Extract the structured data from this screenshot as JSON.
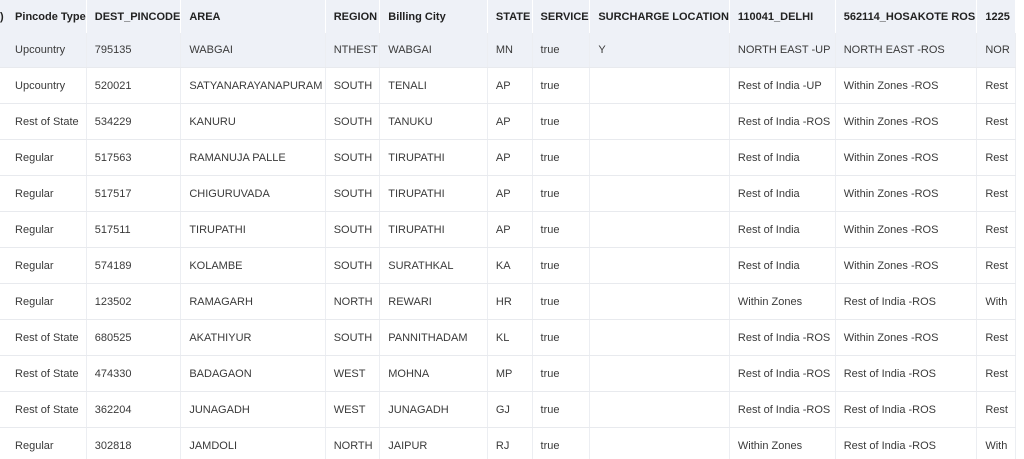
{
  "columns": [
    "Pincode Type",
    "DEST_PINCODE",
    "AREA",
    "REGION",
    "Billing City",
    "STATE",
    "SERVICE",
    "SURCHARGE LOCATION",
    "110041_DELHI",
    "562114_HOSAKOTE ROS",
    "1225"
  ],
  "rows": [
    [
      "Upcountry",
      "795135",
      "WABGAI",
      "NTHEST",
      "WABGAI",
      "MN",
      "true",
      "Y",
      "NORTH EAST -UP",
      "NORTH EAST -ROS",
      "NOR"
    ],
    [
      "Upcountry",
      "520021",
      "SATYANARAYANAPURAM",
      "SOUTH",
      "TENALI",
      "AP",
      "true",
      "",
      "Rest of India -UP",
      "Within Zones -ROS",
      "Rest"
    ],
    [
      "Rest of State",
      "534229",
      "KANURU",
      "SOUTH",
      "TANUKU",
      "AP",
      "true",
      "",
      "Rest of India -ROS",
      "Within Zones -ROS",
      "Rest"
    ],
    [
      "Regular",
      "517563",
      "RAMANUJA PALLE",
      "SOUTH",
      "TIRUPATHI",
      "AP",
      "true",
      "",
      "Rest of India",
      "Within Zones -ROS",
      "Rest"
    ],
    [
      "Regular",
      "517517",
      "CHIGURUVADA",
      "SOUTH",
      "TIRUPATHI",
      "AP",
      "true",
      "",
      "Rest of India",
      "Within Zones -ROS",
      "Rest"
    ],
    [
      "Regular",
      "517511",
      "TIRUPATHI",
      "SOUTH",
      "TIRUPATHI",
      "AP",
      "true",
      "",
      "Rest of India",
      "Within Zones -ROS",
      "Rest"
    ],
    [
      "Regular",
      "574189",
      "KOLAMBE",
      "SOUTH",
      "SURATHKAL",
      "KA",
      "true",
      "",
      "Rest of India",
      "Within Zones -ROS",
      "Rest"
    ],
    [
      "Regular",
      "123502",
      "RAMAGARH",
      "NORTH",
      "REWARI",
      "HR",
      "true",
      "",
      "Within Zones",
      "Rest of India -ROS",
      "With"
    ],
    [
      "Rest of State",
      "680525",
      "AKATHIYUR",
      "SOUTH",
      "PANNITHADAM",
      "KL",
      "true",
      "",
      "Rest of India -ROS",
      "Within Zones -ROS",
      "Rest"
    ],
    [
      "Rest of State",
      "474330",
      "BADAGAON",
      "WEST",
      "MOHNA",
      "MP",
      "true",
      "",
      "Rest of India -ROS",
      "Rest of India -ROS",
      "Rest"
    ],
    [
      "Rest of State",
      "362204",
      "JUNAGADH",
      "WEST",
      "JUNAGADH",
      "GJ",
      "true",
      "",
      "Rest of India -ROS",
      "Rest of India -ROS",
      "Rest"
    ],
    [
      "Regular",
      "302818",
      "JAMDOLI",
      "NORTH",
      "JAIPUR",
      "RJ",
      "true",
      "",
      "Within Zones",
      "Rest of India -ROS",
      "With"
    ]
  ],
  "highlight_row": 0,
  "colors": {
    "header_bg": "#eef1f7",
    "highlight_bg": "#eef1f7",
    "border": "#e8eaee"
  }
}
